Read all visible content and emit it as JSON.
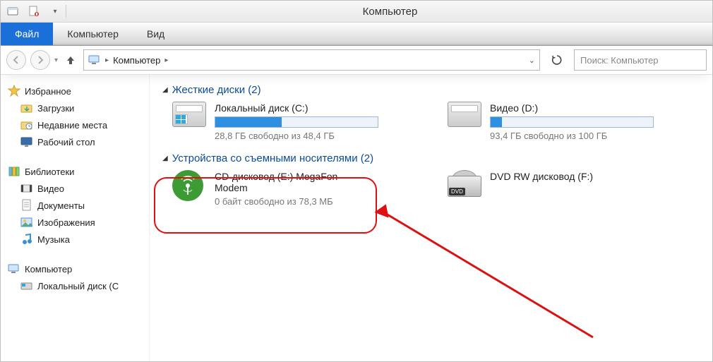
{
  "window": {
    "title": "Компьютер"
  },
  "menubar": {
    "file": "Файл",
    "computer": "Компьютер",
    "view": "Вид"
  },
  "toolbar": {
    "breadcrumb": "Компьютер",
    "search_placeholder": "Поиск: Компьютер"
  },
  "sidebar": {
    "favorites": {
      "label": "Избранное",
      "items": [
        {
          "label": "Загрузки"
        },
        {
          "label": "Недавние места"
        },
        {
          "label": "Рабочий стол"
        }
      ]
    },
    "libraries": {
      "label": "Библиотеки",
      "items": [
        {
          "label": "Видео"
        },
        {
          "label": "Документы"
        },
        {
          "label": "Изображения"
        },
        {
          "label": "Музыка"
        }
      ]
    },
    "computer": {
      "label": "Компьютер",
      "items": [
        {
          "label": "Локальный диск (C"
        }
      ]
    }
  },
  "content": {
    "hdd_section": {
      "label": "Жесткие диски (2)"
    },
    "removable_section": {
      "label": "Устройства со съемными носителями (2)"
    },
    "drives": {
      "c": {
        "name": "Локальный диск (C:)",
        "free_text": "28,8 ГБ свободно из 48,4 ГБ",
        "fill_pct": 41
      },
      "d": {
        "name": "Видео (D:)",
        "free_text": "93,4 ГБ свободно из 100 ГБ",
        "fill_pct": 7
      },
      "e": {
        "name": "CD-дисковод (E:) MegaFon Modem",
        "free_text": "0 байт свободно из 78,3 МБ"
      },
      "f": {
        "name": "DVD RW дисковод (F:)"
      }
    }
  }
}
